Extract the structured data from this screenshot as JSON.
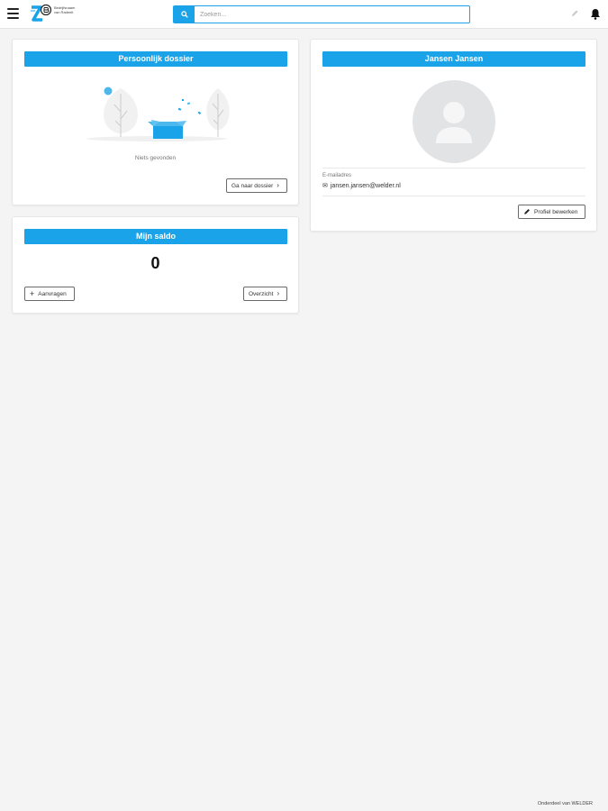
{
  "topbar": {
    "logo_text": "Bedrijfsnaam van Radeelt",
    "search_placeholder": "Zoeken..."
  },
  "dossier": {
    "title": "Persoonlijk dossier",
    "empty_text": "Niets gevonden",
    "button_label": "Ga naar dossier"
  },
  "saldo": {
    "title": "Mijn saldo",
    "value": "0",
    "request_label": "Aanvragen",
    "overview_label": "Overzicht"
  },
  "profile": {
    "name": "Jansen Jansen",
    "email_label": "E-mailadres",
    "email": "jansen.jansen@welder.nl",
    "edit_label": "Profiel bewerken"
  },
  "footer": {
    "text": "Onderdeel van WELDER"
  },
  "colors": {
    "accent": "#1aa3e8",
    "background": "#f4f4f4"
  },
  "icons": [
    "menu-icon",
    "logo",
    "search-icon",
    "pencil-icon",
    "bell-icon",
    "chevron-right-icon",
    "plus-icon",
    "mail-icon",
    "avatar-placeholder"
  ]
}
